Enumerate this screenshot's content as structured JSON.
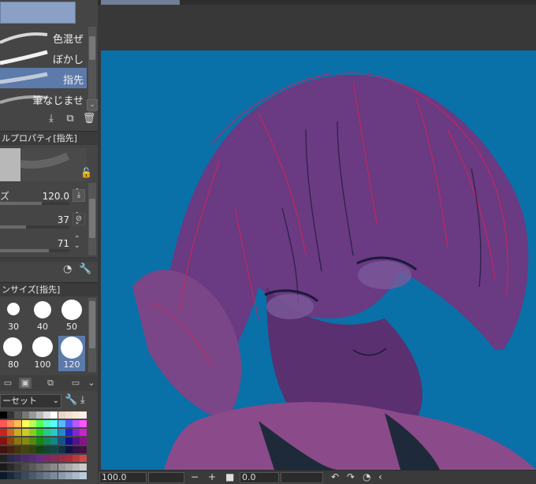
{
  "brush_list": {
    "items": [
      {
        "label": "色混ぜ",
        "selected": false
      },
      {
        "label": "ぼかし",
        "selected": false
      },
      {
        "label": "指先",
        "selected": true
      },
      {
        "label": "筆なじませ",
        "selected": false
      }
    ]
  },
  "tool_property": {
    "header": "ルプロパティ[指先]",
    "rows": [
      {
        "label": "ズ",
        "value": "120.0",
        "fill": 0.6
      },
      {
        "label": "",
        "value": "37",
        "fill": 0.37
      },
      {
        "label": "",
        "value": "71",
        "fill": 0.71
      }
    ]
  },
  "brush_size": {
    "header": "ンサイズ[指先]",
    "sizes": [
      {
        "label": "30",
        "selected": false
      },
      {
        "label": "40",
        "selected": false
      },
      {
        "label": "50",
        "selected": false
      },
      {
        "label": "80",
        "selected": false
      },
      {
        "label": "100",
        "selected": false
      },
      {
        "label": "120",
        "selected": true
      }
    ]
  },
  "preset": {
    "label": "ーセット"
  },
  "status": {
    "zoom": "100.0",
    "angle": "0.0",
    "minus": "−",
    "plus": "+"
  },
  "colors": {
    "selection": "#5c7aaa",
    "canvas_bg": "#0a70a8",
    "skin": "#6a3a82",
    "hair_accent": "#c2285e"
  }
}
